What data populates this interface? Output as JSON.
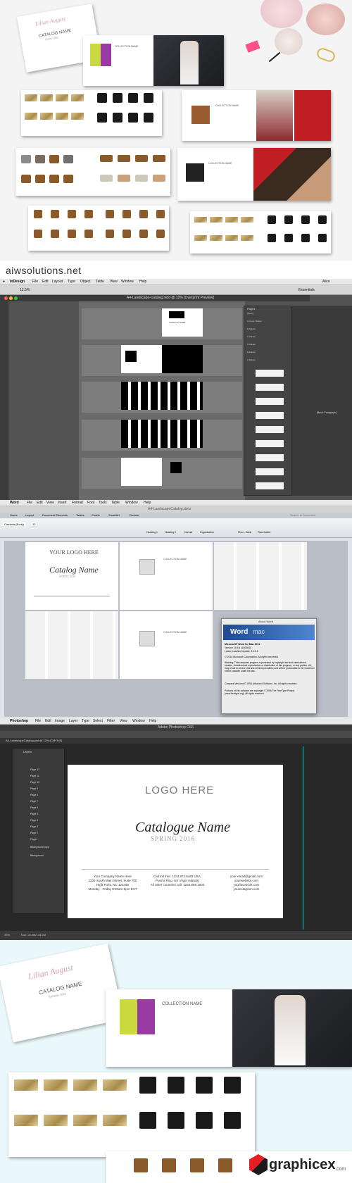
{
  "promo": {
    "domain_watermark": "aiwsolutions.net",
    "catalog_name": "CATALOG NAME",
    "spring": "SPRING 2016",
    "brand_script": "Lilian August",
    "collection_name": "COLLECTION NAME",
    "watermark_logo": "graphicex",
    "watermark_suffix": ".com"
  },
  "indesign": {
    "menu": [
      "InDesign",
      "File",
      "Edit",
      "Layout",
      "Type",
      "Object",
      "Table",
      "View",
      "Window",
      "Help"
    ],
    "clock": "Alice",
    "workspace": "Essentials",
    "doc_title": "A4-Landscape-Catalog.indd @ 12% [Overprint Preview]",
    "zoom": "12.5%",
    "pages_panel_title": "Pages",
    "pages_list": [
      "[None]",
      "A-Cover Master",
      "B-Master",
      "C-Master",
      "D-Master",
      "E-Master",
      "F-Master"
    ],
    "style_label": "[Basic Paragraph]",
    "cover_logo_text": "CATALOG NAME"
  },
  "word": {
    "menu": [
      "Word",
      "File",
      "Edit",
      "View",
      "Insert",
      "Format",
      "Font",
      "Tools",
      "Table",
      "Window",
      "Help"
    ],
    "doc_title": "A4-LandscapeCatalog.docx",
    "ribbon_tabs": [
      "Home",
      "Layout",
      "Document Elements",
      "Tables",
      "Charts",
      "SmartArt",
      "Review"
    ],
    "font_name": "Cambria (Body)",
    "font_size": "12",
    "styles": [
      "Heading 1",
      "Heading 2",
      "Normal",
      "Organisation",
      "Phon - Bank",
      "Placeholder"
    ],
    "search_placeholder": "Search in Document",
    "logo_here": "YOUR LOGO HERE",
    "catalog_script": "Catalog Name",
    "spring": "SPRING 2016",
    "collection_name": "COLLECTION NAME",
    "about": {
      "title": "About Word",
      "product_line1": "Word",
      "product_line2": "mac",
      "name": "Microsoft® Word for Mac 2011",
      "version": "Version 14.5.4 (150504)",
      "update": "Latest Installed Update: 14.5.4",
      "copyright": "© 2010 Microsoft Corporation. All rights reserved.",
      "warning": "Warning: This computer program is protected by copyright law and international treaties. Unauthorized reproduction or distribution of this program, or any portion of it, may result in severe civil and criminal penalties, and will be prosecuted to the maximum extent possible under the law.",
      "compare": "Compare Versions © 1993 Advanced Software, Inc. All rights reserved.",
      "portions": "Portions of this software are copyright © 2006 The FreeType Project (www.freetype.org). All rights reserved."
    }
  },
  "photoshop": {
    "menu": [
      "Photoshop",
      "File",
      "Edit",
      "Image",
      "Layer",
      "Type",
      "Select",
      "Filter",
      "View",
      "Window",
      "Help"
    ],
    "app_title": "Adobe Photoshop CS6",
    "doc_tab": "A4-LandscapeCatalog.psd @ 12% (CMYK/8)",
    "layers_title": "Layers",
    "layers": [
      "Page 12",
      "Page 11",
      "Page 10",
      "Page 9",
      "Page 8",
      "Page 7",
      "Page 6",
      "Page 5",
      "Page 4",
      "Page 3",
      "Page 2",
      "Page1",
      "Background copy",
      "Background"
    ],
    "logo_here": "LOGO HERE",
    "catalogue_name": "Catalogue Name",
    "spring": "SPRING 2016",
    "contact_left": [
      "Your Company Name Here",
      "1234 South Main Street, Suite 700",
      "High Point, NC 123456",
      "Monday - Friday 8:00am-5pm EST"
    ],
    "contact_mid": [
      "Call toll free: 1234.874.6492 USA,",
      "Puerto Rico, US Virgin Islands)",
      "All other countries call: 1234.869.1000"
    ],
    "contact_right": [
      "your-email@gmail.com",
      "yourwebsite.com",
      "yourfacebook.com",
      "youinstagram.com"
    ],
    "status_zoom": "25%",
    "doc_size": "Doc: 23.0M/144.2M"
  },
  "colors": {
    "indesign_bg": "#535353",
    "word_bg": "#dfe3ea",
    "photoshop_bg": "#282828",
    "accent_pink": "#ff4f8b",
    "watermark_red": "#e31e24",
    "promo_bottom_bg": "#eaf8fb"
  }
}
